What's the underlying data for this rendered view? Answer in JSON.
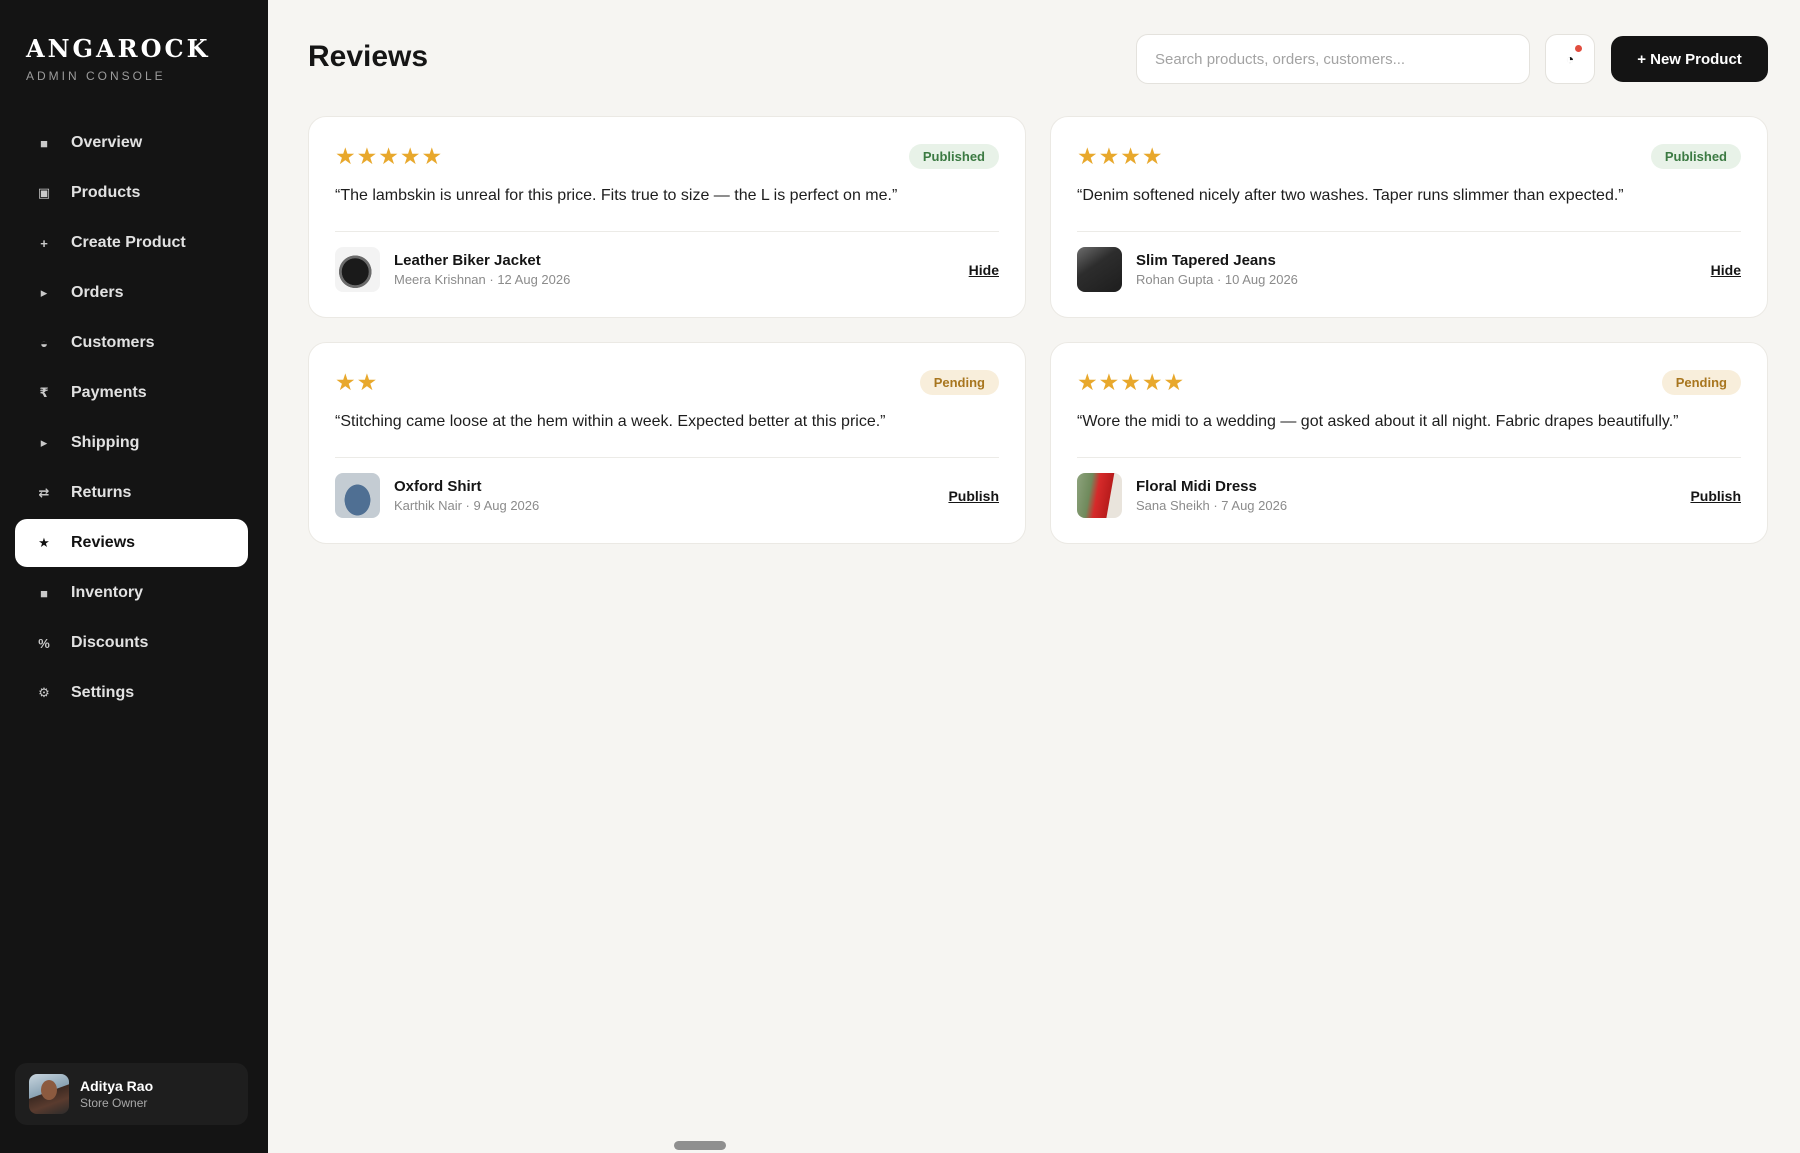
{
  "brand": {
    "name": "ANGAROCK",
    "subtitle": "ADMIN CONSOLE"
  },
  "sidebar": {
    "items": [
      {
        "label": "Overview",
        "icon": "■",
        "icon_name": "square-icon",
        "active": false
      },
      {
        "label": "Products",
        "icon": "▣",
        "icon_name": "box-icon",
        "active": false
      },
      {
        "label": "Create Product",
        "icon": "+",
        "icon_name": "plus-icon",
        "active": false
      },
      {
        "label": "Orders",
        "icon": "▸",
        "icon_name": "triangle-right-icon",
        "active": false
      },
      {
        "label": "Customers",
        "icon": "◒",
        "icon_name": "half-circle-icon",
        "active": false
      },
      {
        "label": "Payments",
        "icon": "₹",
        "icon_name": "rupee-icon",
        "active": false
      },
      {
        "label": "Shipping",
        "icon": "▸",
        "icon_name": "triangle-right-icon",
        "active": false
      },
      {
        "label": "Returns",
        "icon": "⇄",
        "icon_name": "swap-arrows-icon",
        "active": false
      },
      {
        "label": "Reviews",
        "icon": "★",
        "icon_name": "star-icon",
        "active": true
      },
      {
        "label": "Inventory",
        "icon": "■",
        "icon_name": "square-icon",
        "active": false
      },
      {
        "label": "Discounts",
        "icon": "%",
        "icon_name": "percent-icon",
        "active": false
      },
      {
        "label": "Settings",
        "icon": "⚙",
        "icon_name": "gear-icon",
        "active": false
      }
    ]
  },
  "user": {
    "name": "Aditya Rao",
    "role": "Store Owner"
  },
  "header": {
    "title": "Reviews",
    "search_placeholder": "Search products, orders, customers...",
    "notification_icon": "◔",
    "new_button_label": "+ New Product"
  },
  "colors": {
    "sidebar_bg": "#141414",
    "page_bg": "#f6f5f2",
    "star": "#e8a82c",
    "published_text": "#3b7a42",
    "pending_text": "#a8761f",
    "notification_dot": "#e14d3f"
  },
  "reviews": [
    {
      "rating": 5,
      "stars": "★★★★★",
      "status": "Published",
      "quote": "“The lambskin is unreal for this price. Fits true to size — the L is perfect on me.”",
      "product": "Leather Biker Jacket",
      "meta": "Meera Krishnan · 12 Aug 2026",
      "action": "Hide"
    },
    {
      "rating": 4,
      "stars": "★★★★",
      "status": "Published",
      "quote": "“Denim softened nicely after two washes. Taper runs slimmer than expected.”",
      "product": "Slim Tapered Jeans",
      "meta": "Rohan Gupta · 10 Aug 2026",
      "action": "Hide"
    },
    {
      "rating": 2,
      "stars": "★★",
      "status": "Pending",
      "quote": "“Stitching came loose at the hem within a week. Expected better at this price.”",
      "product": "Oxford Shirt",
      "meta": "Karthik Nair · 9 Aug 2026",
      "action": "Publish"
    },
    {
      "rating": 5,
      "stars": "★★★★★",
      "status": "Pending",
      "quote": "“Wore the midi to a wedding — got asked about it all night. Fabric drapes beautifully.”",
      "product": "Floral Midi Dress",
      "meta": "Sana Sheikh · 7 Aug 2026",
      "action": "Publish"
    }
  ]
}
